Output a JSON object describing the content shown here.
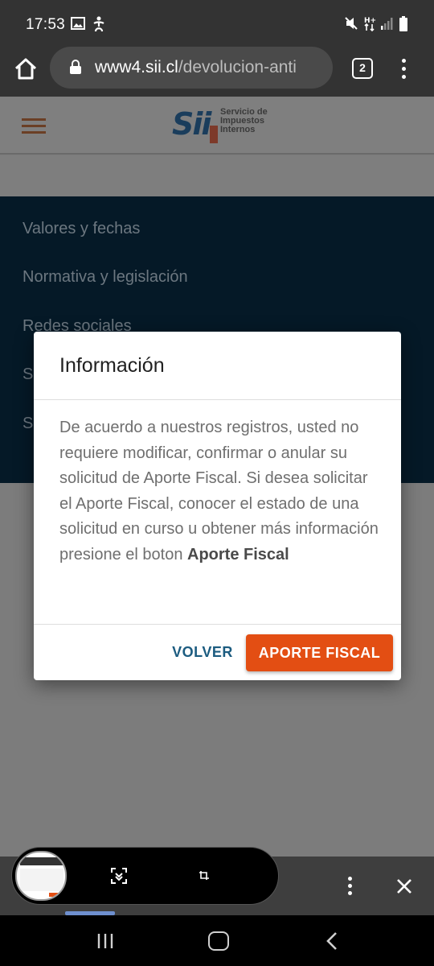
{
  "status_bar": {
    "time": "17:53",
    "left_icons": [
      "image-icon",
      "accessibility-icon"
    ],
    "right_icons": [
      "mute-icon",
      "hplus-data-icon",
      "signal-icon",
      "battery-icon"
    ]
  },
  "browser": {
    "domain": "www4.sii.cl",
    "path": "/devolucion-anti",
    "tab_count": "2"
  },
  "site": {
    "logo_text_line1": "Servicio de",
    "logo_text_line2": "Impuestos",
    "logo_text_line3": "Internos",
    "logo_mark": "Sii",
    "nav_items": [
      "Valores y fechas",
      "Normativa y legislación",
      "Redes sociales",
      "S",
      "S"
    ]
  },
  "modal": {
    "title": "Información",
    "body_text": "De acuerdo a nuestros registros, usted no requiere modificar, confirmar o anular su solicitud de Aporte Fiscal. Si desea solicitar el Aporte Fiscal, conocer el estado de una solicitud en curso u obtener más información presione el boton ",
    "body_bold": "Aporte Fiscal",
    "volver_label": "VOLVER",
    "aporte_label": "APORTE FISCAL",
    "accent_color": "#e34e13",
    "link_color": "#1c5c80"
  },
  "screenshot_toolbar": {
    "icons": [
      "scroll-capture-icon",
      "crop-icon",
      "more-options-icon",
      "close-icon"
    ]
  },
  "system_nav": {
    "icons": [
      "recent-apps-icon",
      "home-icon",
      "back-icon"
    ]
  }
}
